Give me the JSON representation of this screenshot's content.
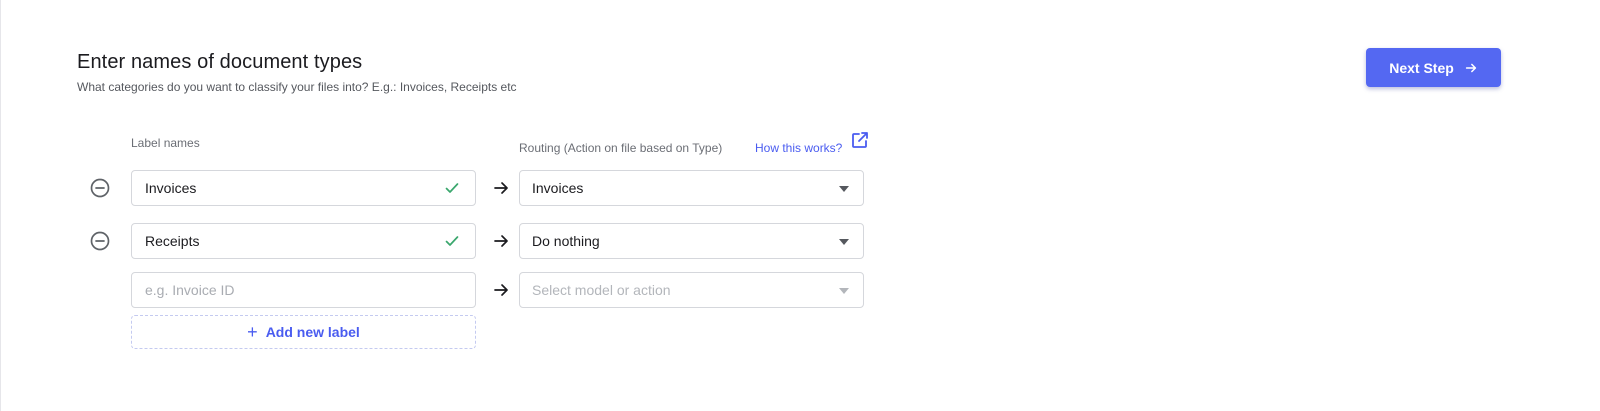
{
  "header": {
    "title": "Enter names of document types",
    "subtitle": "What categories do you want to classify your files into? E.g.: Invoices, Receipts etc",
    "next_button": "Next Step"
  },
  "columns": {
    "label_names": "Label names",
    "routing": "Routing (Action on file based on Type)",
    "help_link": "How this works?"
  },
  "rows": [
    {
      "label": "Invoices",
      "validated": true,
      "routing": "Invoices"
    },
    {
      "label": "Receipts",
      "validated": true,
      "routing": "Do nothing"
    }
  ],
  "new_row": {
    "label_placeholder": "e.g. Invoice ID",
    "routing_placeholder": "Select model or action"
  },
  "add_label": {
    "icon": "plus-icon",
    "text": "Add new label"
  },
  "colors": {
    "accent": "#5468f2",
    "link": "#4a5cf0",
    "success": "#3aa76d",
    "border": "#d5d7dc"
  }
}
